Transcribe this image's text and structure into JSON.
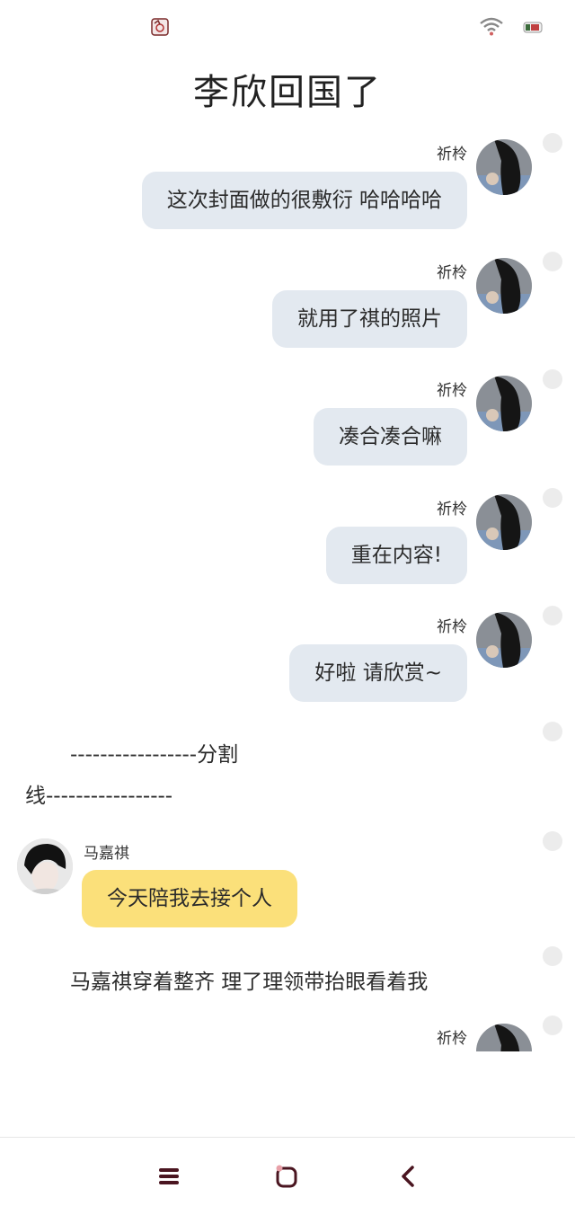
{
  "title": "李欣回国了",
  "messages": [
    {
      "sender": "祈柃",
      "text": "这次封面做的很敷衍 哈哈哈哈"
    },
    {
      "sender": "祈柃",
      "text": "就用了祺的照片"
    },
    {
      "sender": "祈柃",
      "text": "凑合凑合嘛"
    },
    {
      "sender": "祈柃",
      "text": "重在内容!"
    },
    {
      "sender": "祈柃",
      "text": "好啦 请欣赏~"
    }
  ],
  "divider": {
    "line1": "-----------------分割",
    "line2": "线-----------------"
  },
  "message_left": {
    "sender": "马嘉祺",
    "text": "今天陪我去接个人"
  },
  "narration": "马嘉祺穿着整齐 理了理领带抬眼看着我",
  "last_sender": "祈柃",
  "colors": {
    "right_bubble": "#e3e9f0",
    "left_bubble": "#fbe07a",
    "nav_icon": "#4a1520"
  },
  "icons": {
    "status_app": "app-icon",
    "wifi": "wifi-icon",
    "battery": "battery-icon",
    "nav_menu": "menu-icon",
    "nav_home": "home-icon",
    "nav_back": "back-icon"
  }
}
